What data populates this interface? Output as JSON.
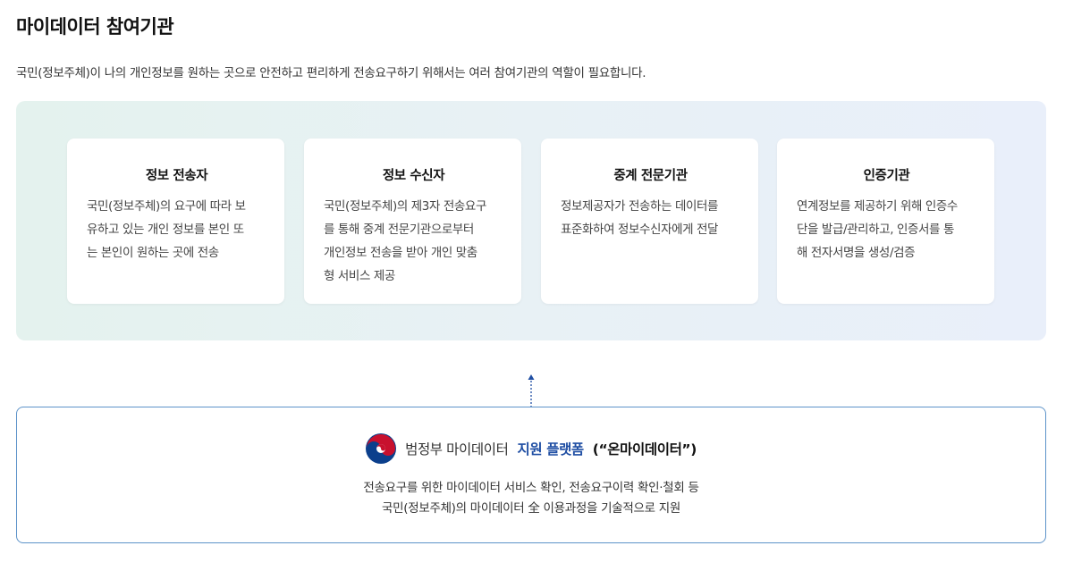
{
  "title": "마이데이터 참여기관",
  "description": "국민(정보주체)이 나의 개인정보를 원하는 곳으로 안전하고 편리하게 전송요구하기 위해서는 여러 참여기관의 역할이 필요합니다.",
  "roles": [
    {
      "title": "정보 전송자",
      "lines": [
        "국민(정보주체)의 요구에 따라 보",
        "유하고 있는 개인 정보를 본인 또",
        "는 본인이 원하는 곳에 전송"
      ]
    },
    {
      "title": "정보 수신자",
      "lines": [
        "국민(정보주체)의 제3자 전송요구",
        "를 통해 중계 전문기관으로부터",
        "개인정보 전송을 받아 개인 맞춤",
        "형 서비스 제공"
      ]
    },
    {
      "title": "중계 전문기관",
      "lines": [
        "정보제공자가 전송하는 데이터를",
        "표준화하여 정보수신자에게 전달"
      ]
    },
    {
      "title": "인증기관",
      "lines": [
        "연계정보를 제공하기 위해 인증수",
        "단을 발급/관리하고, 인증서를 통",
        "해 전자서명을 생성/검증"
      ]
    }
  ],
  "platform": {
    "ministry": "범정부 마이데이터",
    "name": "지원 플랫폼",
    "brand": "(“온마이데이터”)",
    "desc_line1": "전송요구를 위한 마이데이터 서비스 확인, 전송요구이력 확인·철회 등",
    "desc_line2": "국민(정보주체)의 마이데이터 全 이용과정을 기술적으로 지원"
  },
  "colors": {
    "accent": "#1f4ea3",
    "border": "#5d93c9",
    "emblem_red": "#c8102e",
    "emblem_blue": "#0b3f8c"
  },
  "icons": {
    "emblem": "government-emblem-icon",
    "connector": "arrow-up-icon"
  }
}
